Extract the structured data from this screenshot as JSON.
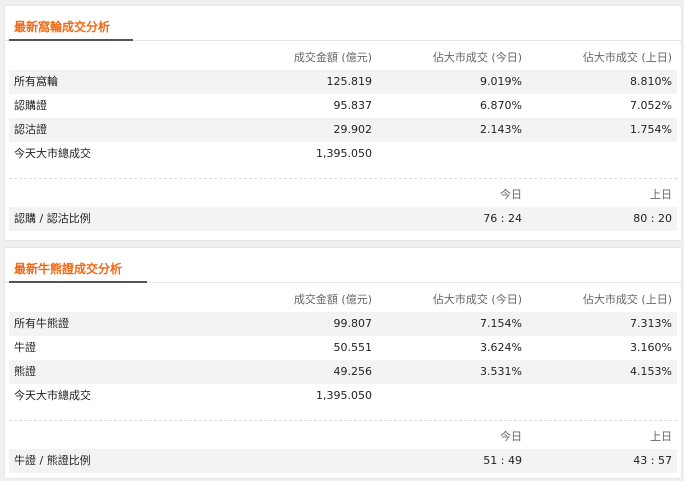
{
  "warrants": {
    "title": "最新窩輪成交分析",
    "headers": [
      "成交金額 (億元)",
      "佔大市成交 (今日)",
      "佔大市成交 (上日)"
    ],
    "rows": [
      {
        "label": "所有窩輪",
        "amount": "125.819",
        "today": "9.019%",
        "prev": "8.810%"
      },
      {
        "label": "認購證",
        "amount": "95.837",
        "today": "6.870%",
        "prev": "7.052%"
      },
      {
        "label": "認沽證",
        "amount": "29.902",
        "today": "2.143%",
        "prev": "1.754%"
      },
      {
        "label": "今天大市總成交",
        "amount": "1,395.050",
        "today": "",
        "prev": ""
      }
    ],
    "ratio_headers": [
      "今日",
      "上日"
    ],
    "ratio": {
      "label": "認購 / 認沽比例",
      "today": "76 : 24",
      "prev": "80 : 20"
    }
  },
  "cbbc": {
    "title": "最新牛熊證成交分析",
    "headers": [
      "成交金額 (億元)",
      "佔大市成交 (今日)",
      "佔大市成交 (上日)"
    ],
    "rows": [
      {
        "label": "所有牛熊證",
        "amount": "99.807",
        "today": "7.154%",
        "prev": "7.313%"
      },
      {
        "label": "牛證",
        "amount": "50.551",
        "today": "3.624%",
        "prev": "3.160%"
      },
      {
        "label": "熊證",
        "amount": "49.256",
        "today": "3.531%",
        "prev": "4.153%"
      },
      {
        "label": "今天大市總成交",
        "amount": "1,395.050",
        "today": "",
        "prev": ""
      }
    ],
    "ratio_headers": [
      "今日",
      "上日"
    ],
    "ratio": {
      "label": "牛證 / 熊證比例",
      "today": "51 : 49",
      "prev": "43 : 57"
    }
  }
}
